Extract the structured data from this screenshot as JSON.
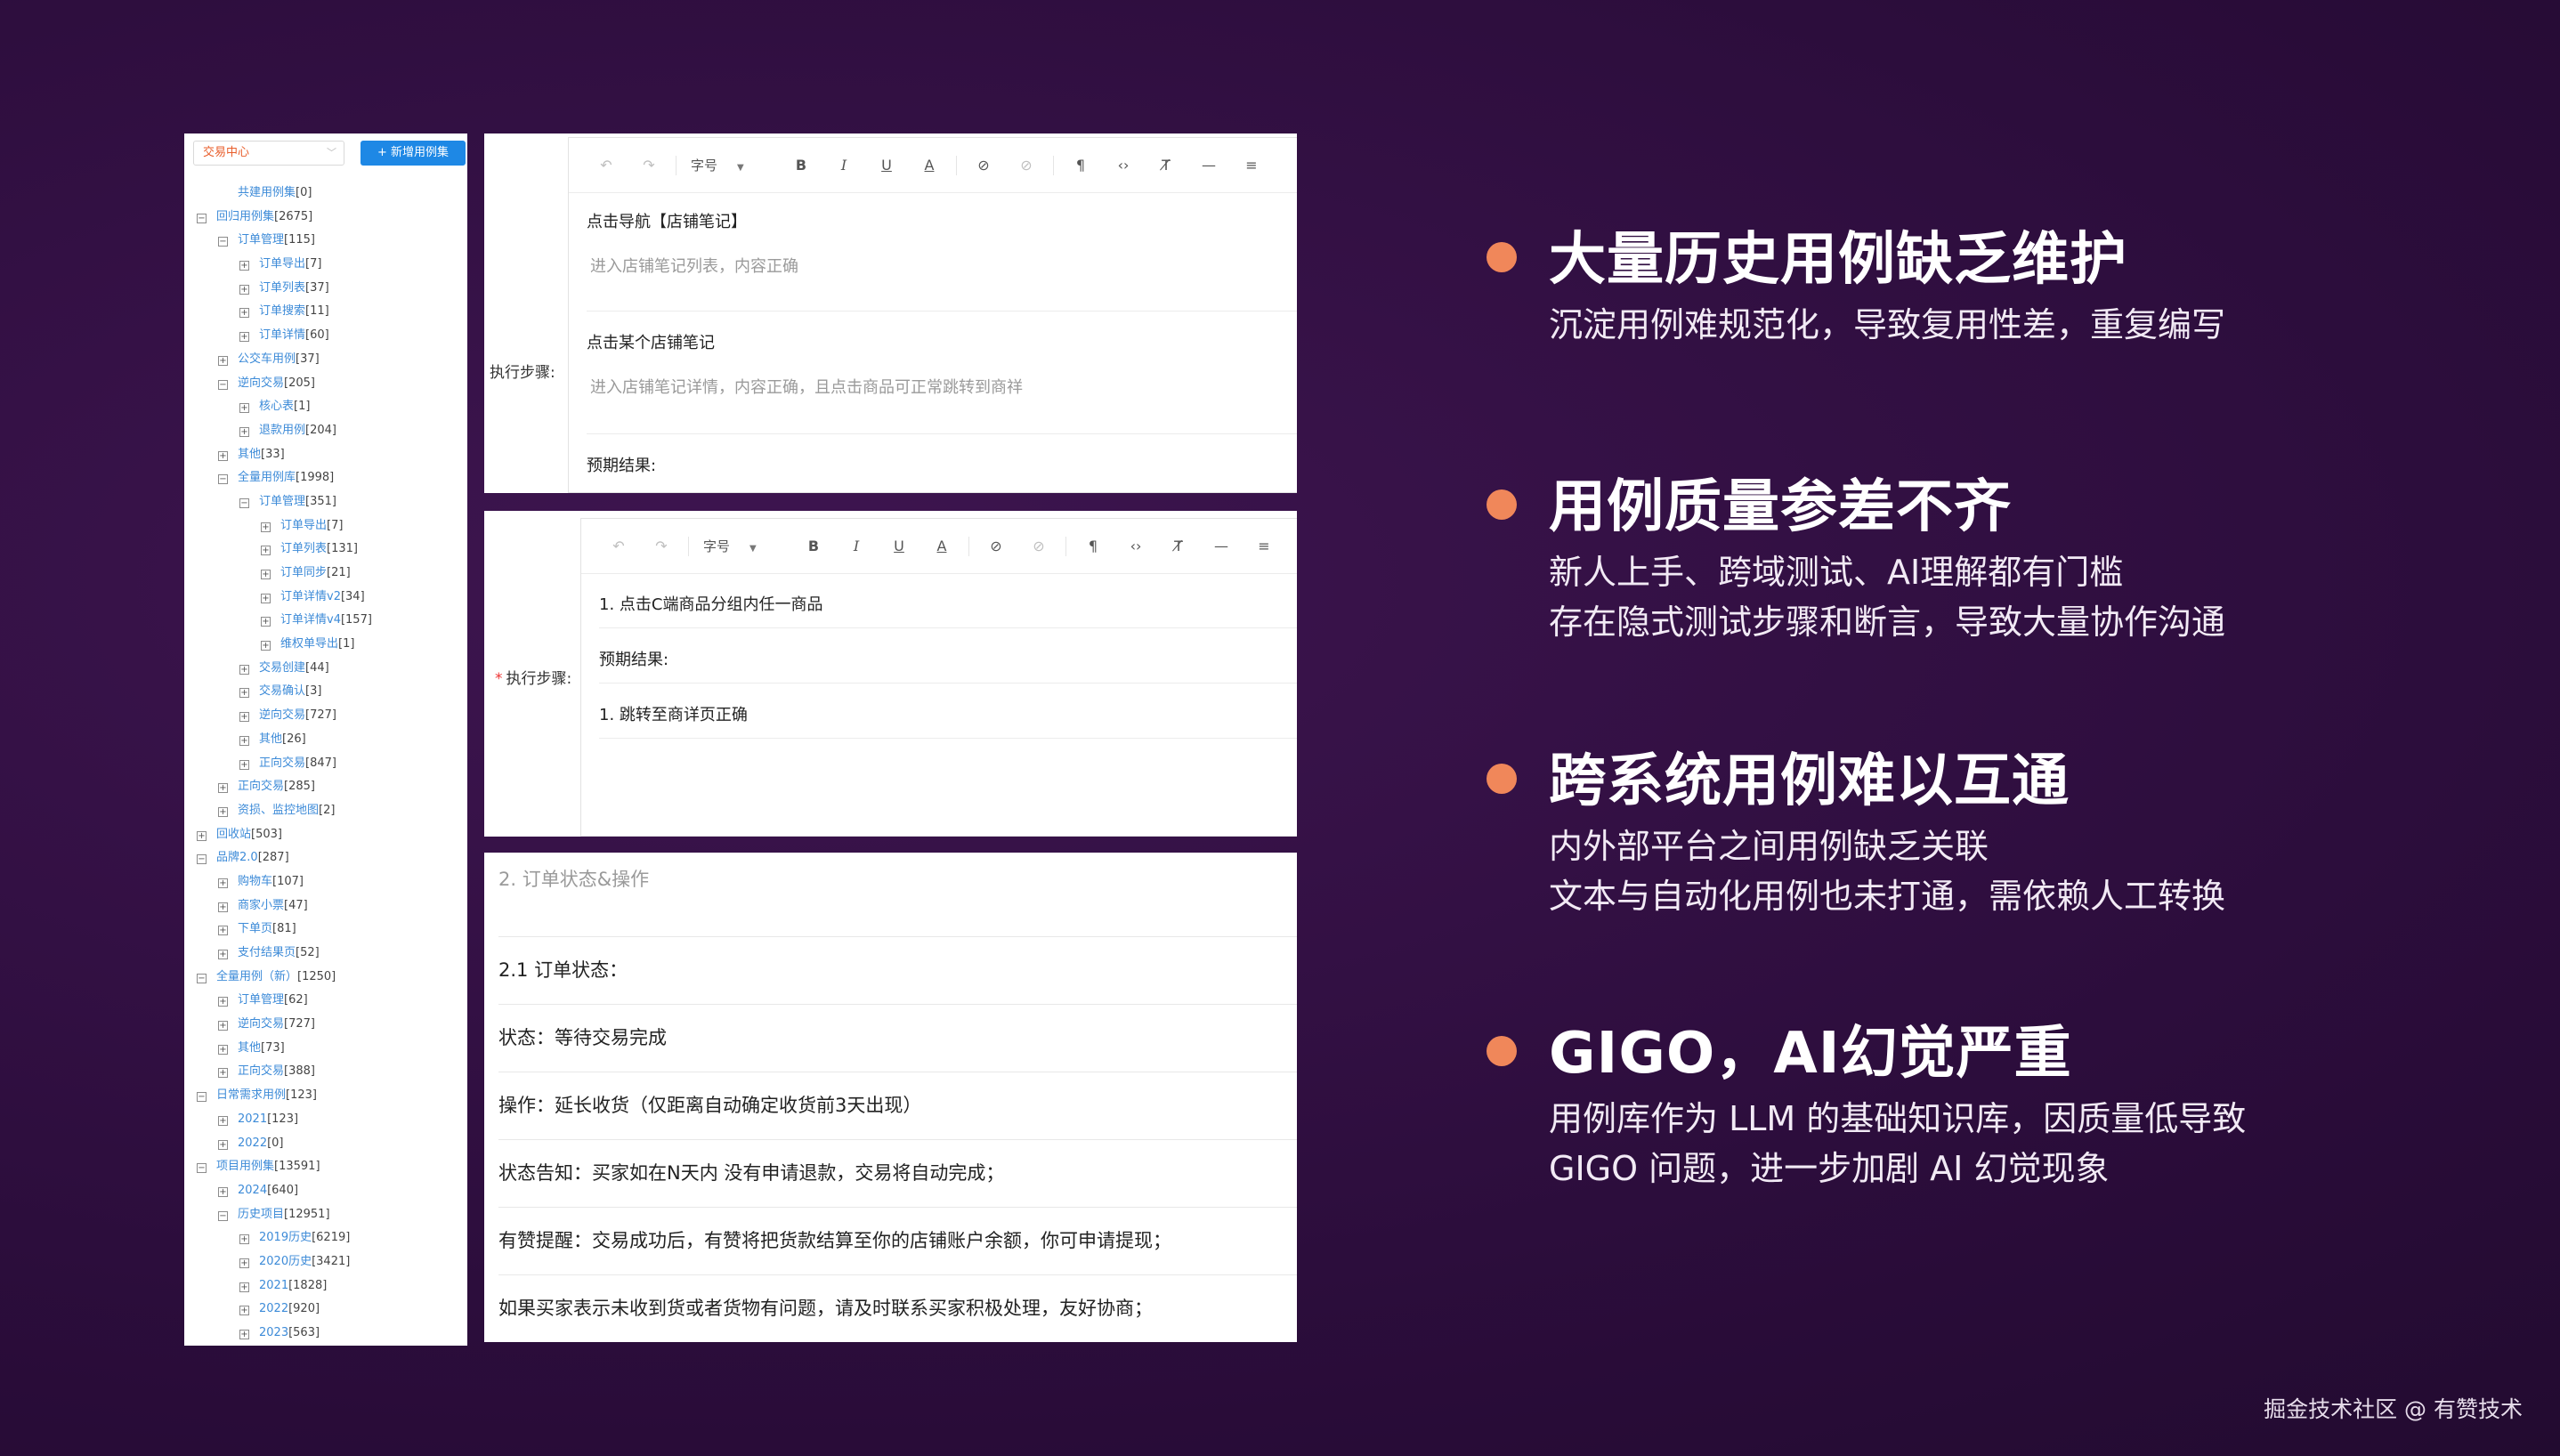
{
  "tree": {
    "select_value": "交易中心",
    "add_button_label": "+ 新增用例集",
    "nodes": [
      {
        "level": 1,
        "toggle": "",
        "name": "共建用例集",
        "count": "[0]"
      },
      {
        "level": 0,
        "toggle": "−",
        "name": "回归用例集",
        "count": "[2675]"
      },
      {
        "level": 1,
        "toggle": "−",
        "name": "订单管理",
        "count": "[115]"
      },
      {
        "level": 2,
        "toggle": "+",
        "name": "订单导出",
        "count": "[7]"
      },
      {
        "level": 2,
        "toggle": "+",
        "name": "订单列表",
        "count": "[37]"
      },
      {
        "level": 2,
        "toggle": "+",
        "name": "订单搜索",
        "count": "[11]"
      },
      {
        "level": 2,
        "toggle": "+",
        "name": "订单详情",
        "count": "[60]"
      },
      {
        "level": 1,
        "toggle": "+",
        "name": "公交车用例",
        "count": "[37]"
      },
      {
        "level": 1,
        "toggle": "−",
        "name": "逆向交易",
        "count": "[205]"
      },
      {
        "level": 2,
        "toggle": "+",
        "name": "核心表",
        "count": "[1]"
      },
      {
        "level": 2,
        "toggle": "+",
        "name": "退款用例",
        "count": "[204]"
      },
      {
        "level": 1,
        "toggle": "+",
        "name": "其他",
        "count": "[33]"
      },
      {
        "level": 1,
        "toggle": "−",
        "name": "全量用例库",
        "count": "[1998]"
      },
      {
        "level": 2,
        "toggle": "−",
        "name": "订单管理",
        "count": "[351]"
      },
      {
        "level": 3,
        "toggle": "+",
        "name": "订单导出",
        "count": "[7]"
      },
      {
        "level": 3,
        "toggle": "+",
        "name": "订单列表",
        "count": "[131]"
      },
      {
        "level": 3,
        "toggle": "+",
        "name": "订单同步",
        "count": "[21]"
      },
      {
        "level": 3,
        "toggle": "+",
        "name": "订单详情v2",
        "count": "[34]"
      },
      {
        "level": 3,
        "toggle": "+",
        "name": "订单详情v4",
        "count": "[157]"
      },
      {
        "level": 3,
        "toggle": "+",
        "name": "维权单导出",
        "count": "[1]"
      },
      {
        "level": 2,
        "toggle": "+",
        "name": "交易创建",
        "count": "[44]"
      },
      {
        "level": 2,
        "toggle": "+",
        "name": "交易确认",
        "count": "[3]"
      },
      {
        "level": 2,
        "toggle": "+",
        "name": "逆向交易",
        "count": "[727]"
      },
      {
        "level": 2,
        "toggle": "+",
        "name": "其他",
        "count": "[26]"
      },
      {
        "level": 2,
        "toggle": "+",
        "name": "正向交易",
        "count": "[847]"
      },
      {
        "level": 1,
        "toggle": "+",
        "name": "正向交易",
        "count": "[285]"
      },
      {
        "level": 1,
        "toggle": "+",
        "name": "资损、监控地图",
        "count": "[2]"
      },
      {
        "level": 0,
        "toggle": "+",
        "name": "回收站",
        "count": "[503]"
      },
      {
        "level": 0,
        "toggle": "−",
        "name": "品牌2.0",
        "count": "[287]"
      },
      {
        "level": 1,
        "toggle": "+",
        "name": "购物车",
        "count": "[107]"
      },
      {
        "level": 1,
        "toggle": "+",
        "name": "商家小票",
        "count": "[47]"
      },
      {
        "level": 1,
        "toggle": "+",
        "name": "下单页",
        "count": "[81]"
      },
      {
        "level": 1,
        "toggle": "+",
        "name": "支付结果页",
        "count": "[52]"
      },
      {
        "level": 0,
        "toggle": "−",
        "name": "全量用例（新）",
        "count": "[1250]"
      },
      {
        "level": 1,
        "toggle": "+",
        "name": "订单管理",
        "count": "[62]"
      },
      {
        "level": 1,
        "toggle": "+",
        "name": "逆向交易",
        "count": "[727]"
      },
      {
        "level": 1,
        "toggle": "+",
        "name": "其他",
        "count": "[73]"
      },
      {
        "level": 1,
        "toggle": "+",
        "name": "正向交易",
        "count": "[388]"
      },
      {
        "level": 0,
        "toggle": "−",
        "name": "日常需求用例",
        "count": "[123]"
      },
      {
        "level": 1,
        "toggle": "+",
        "name": "2021",
        "count": "[123]"
      },
      {
        "level": 1,
        "toggle": "+",
        "name": "2022",
        "count": "[0]"
      },
      {
        "level": 0,
        "toggle": "−",
        "name": "项目用例集",
        "count": "[13591]"
      },
      {
        "level": 1,
        "toggle": "+",
        "name": "2024",
        "count": "[640]"
      },
      {
        "level": 1,
        "toggle": "−",
        "name": "历史项目",
        "count": "[12951]"
      },
      {
        "level": 2,
        "toggle": "+",
        "name": "2019历史",
        "count": "[6219]"
      },
      {
        "level": 2,
        "toggle": "+",
        "name": "2020历史",
        "count": "[3421]"
      },
      {
        "level": 2,
        "toggle": "+",
        "name": "2021",
        "count": "[1828]"
      },
      {
        "level": 2,
        "toggle": "+",
        "name": "2022",
        "count": "[920]"
      },
      {
        "level": 2,
        "toggle": "+",
        "name": "2023",
        "count": "[563]"
      }
    ]
  },
  "editor1": {
    "step_label": "执行步骤:",
    "font_size_label": "字号",
    "lines": {
      "l1": "点击导航【店铺笔记】",
      "l2": "进入店铺笔记列表，内容正确",
      "l3": "点击某个店铺笔记",
      "l4": "进入店铺笔记详情，内容正确，且点击商品可正常跳转到商祥",
      "l5": "预期结果:"
    }
  },
  "editor2": {
    "required_mark": "*",
    "step_label": "执行步骤:",
    "font_size_label": "字号",
    "lines": {
      "l1": "1. 点击C端商品分组内任一商品",
      "l2": "预期结果:",
      "l3": "1. 跳转至商详页正确"
    }
  },
  "doc": {
    "heading": "2. 订单状态&操作",
    "lines": [
      "2.1 订单状态：",
      "状态：等待交易完成",
      "操作：延长收货（仅距离自动确定收货前3天出现）",
      "状态告知：买家如在N天内 没有申请退款，交易将自动完成；",
      "有赞提醒：交易成功后，有赞将把货款结算至你的店铺账户余额，你可申请提现；",
      "如果买家表示未收到货或者货物有问题，请及时联系买家积极处理，友好协商；"
    ]
  },
  "bullets": [
    {
      "title": "大量历史用例缺乏维护",
      "lines": [
        "沉淀用例难规范化，导致复用性差，重复编写"
      ]
    },
    {
      "title": "用例质量参差不齐",
      "lines": [
        "新人上手、跨域测试、AI理解都有门槛",
        "存在隐式测试步骤和断言，导致大量协作沟通"
      ]
    },
    {
      "title": "跨系统用例难以互通",
      "lines": [
        "内外部平台之间用例缺乏关联",
        "文本与自动化用例也未打通，需依赖人工转换"
      ]
    },
    {
      "title": "GIGO，AI幻觉严重",
      "lines": [
        "用例库作为 LLM 的基础知识库，因质量低导致",
        "GIGO 问题，进一步加剧 AI 幻觉现象"
      ]
    }
  ],
  "footer": "掘金技术社区 @ 有赞技术",
  "colors": {
    "accent_dot": "#f0875a",
    "tree_link": "#3d8bd8",
    "add_button": "#1e88e5"
  }
}
